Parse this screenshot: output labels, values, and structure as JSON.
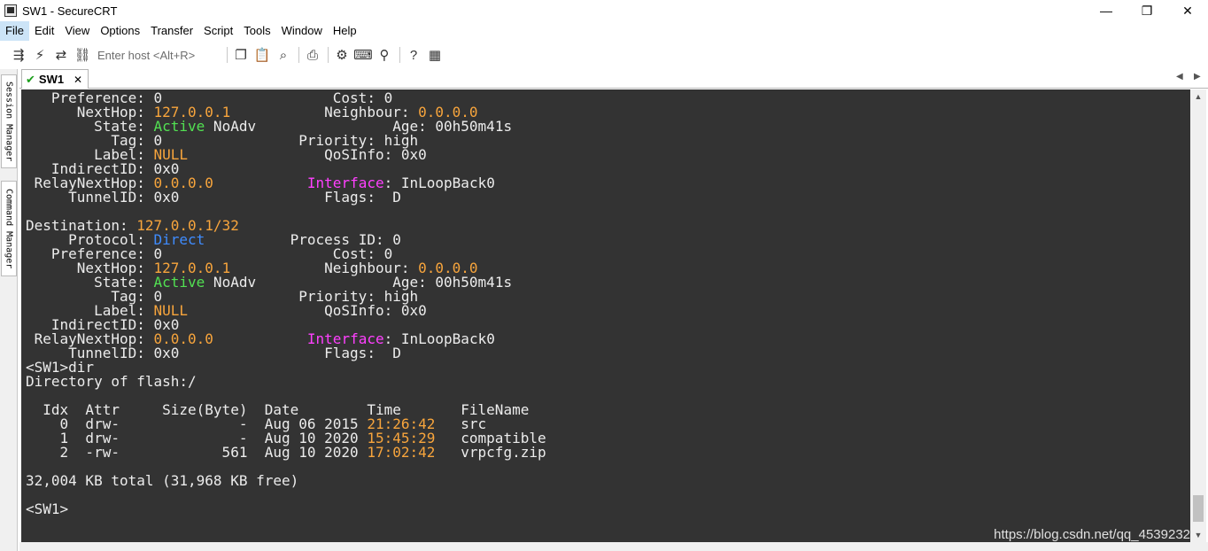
{
  "window": {
    "title": "SW1 - SecureCRT",
    "minimize_glyph": "—",
    "restore_glyph": "❐",
    "close_glyph": "✕"
  },
  "menu": {
    "items": [
      "File",
      "Edit",
      "View",
      "Options",
      "Transfer",
      "Script",
      "Tools",
      "Window",
      "Help"
    ]
  },
  "toolbar": {
    "host_placeholder": "Enter host <Alt+R>",
    "icons": [
      "connect-icon",
      "quick-connect-icon",
      "reconnect-icon",
      "disconnect-icon",
      "copy-icon",
      "paste-icon",
      "find-icon",
      "print-icon",
      "settings-icon",
      "keymap-icon",
      "sftp-icon",
      "help-icon",
      "script-icon"
    ]
  },
  "sidebar": {
    "session_manager": "Session Manager",
    "command_manager": "Command Manager"
  },
  "tab": {
    "label": "SW1"
  },
  "watermark": "https://blog.csdn.net/qq_4539232",
  "colors": {
    "terminal_bg": "#333333",
    "terminal_fg": "#ececec",
    "orange": "#f8a53c",
    "green": "#52e052",
    "blue": "#3f8cff",
    "magenta": "#ff40ff"
  },
  "terminal": {
    "lines": [
      [
        {
          "t": "   Preference: 0                    Cost: 0"
        }
      ],
      [
        {
          "t": "      NextHop: "
        },
        {
          "t": "127.0.0.1",
          "c": "orange"
        },
        {
          "t": "           Neighbour: "
        },
        {
          "t": "0.0.0.0",
          "c": "orange"
        }
      ],
      [
        {
          "t": "        State: "
        },
        {
          "t": "Active",
          "c": "green"
        },
        {
          "t": " NoAdv                Age: 00h50m41s"
        }
      ],
      [
        {
          "t": "          Tag: 0                Priority: high"
        }
      ],
      [
        {
          "t": "        Label: "
        },
        {
          "t": "NULL",
          "c": "orange"
        },
        {
          "t": "                QoSInfo: 0x0"
        }
      ],
      [
        {
          "t": "   IndirectID: 0x0"
        }
      ],
      [
        {
          "t": " RelayNextHop: "
        },
        {
          "t": "0.0.0.0",
          "c": "orange"
        },
        {
          "t": "           "
        },
        {
          "t": "Interface",
          "c": "magenta"
        },
        {
          "t": ": InLoopBack0"
        }
      ],
      [
        {
          "t": "     TunnelID: 0x0                 Flags:  D"
        }
      ],
      [
        {
          "t": ""
        }
      ],
      [
        {
          "t": "Destination: "
        },
        {
          "t": "127.0.0.1/32",
          "c": "orange"
        }
      ],
      [
        {
          "t": "     Protocol: "
        },
        {
          "t": "Direct",
          "c": "blue"
        },
        {
          "t": "          Process ID: 0"
        }
      ],
      [
        {
          "t": "   Preference: 0                    Cost: 0"
        }
      ],
      [
        {
          "t": "      NextHop: "
        },
        {
          "t": "127.0.0.1",
          "c": "orange"
        },
        {
          "t": "           Neighbour: "
        },
        {
          "t": "0.0.0.0",
          "c": "orange"
        }
      ],
      [
        {
          "t": "        State: "
        },
        {
          "t": "Active",
          "c": "green"
        },
        {
          "t": " NoAdv                Age: 00h50m41s"
        }
      ],
      [
        {
          "t": "          Tag: 0                Priority: high"
        }
      ],
      [
        {
          "t": "        Label: "
        },
        {
          "t": "NULL",
          "c": "orange"
        },
        {
          "t": "                QoSInfo: 0x0"
        }
      ],
      [
        {
          "t": "   IndirectID: 0x0"
        }
      ],
      [
        {
          "t": " RelayNextHop: "
        },
        {
          "t": "0.0.0.0",
          "c": "orange"
        },
        {
          "t": "           "
        },
        {
          "t": "Interface",
          "c": "magenta"
        },
        {
          "t": ": InLoopBack0"
        }
      ],
      [
        {
          "t": "     TunnelID: 0x0                 Flags:  D"
        }
      ],
      [
        {
          "t": "<SW1>dir"
        }
      ],
      [
        {
          "t": "Directory of flash:/"
        }
      ],
      [
        {
          "t": ""
        }
      ],
      [
        {
          "t": "  Idx  Attr     Size(Byte)  Date        Time       FileName"
        }
      ],
      [
        {
          "t": "    0  drw-              -  Aug 06 2015 "
        },
        {
          "t": "21:26:42",
          "c": "orange"
        },
        {
          "t": "   src"
        }
      ],
      [
        {
          "t": "    1  drw-              -  Aug 10 2020 "
        },
        {
          "t": "15:45:29",
          "c": "orange"
        },
        {
          "t": "   compatible"
        }
      ],
      [
        {
          "t": "    2  -rw-            561  Aug 10 2020 "
        },
        {
          "t": "17:02:42",
          "c": "orange"
        },
        {
          "t": "   vrpcfg.zip"
        }
      ],
      [
        {
          "t": ""
        }
      ],
      [
        {
          "t": "32,004 KB total (31,968 KB free)"
        }
      ],
      [
        {
          "t": ""
        }
      ],
      [
        {
          "t": "<SW1>"
        }
      ]
    ]
  }
}
